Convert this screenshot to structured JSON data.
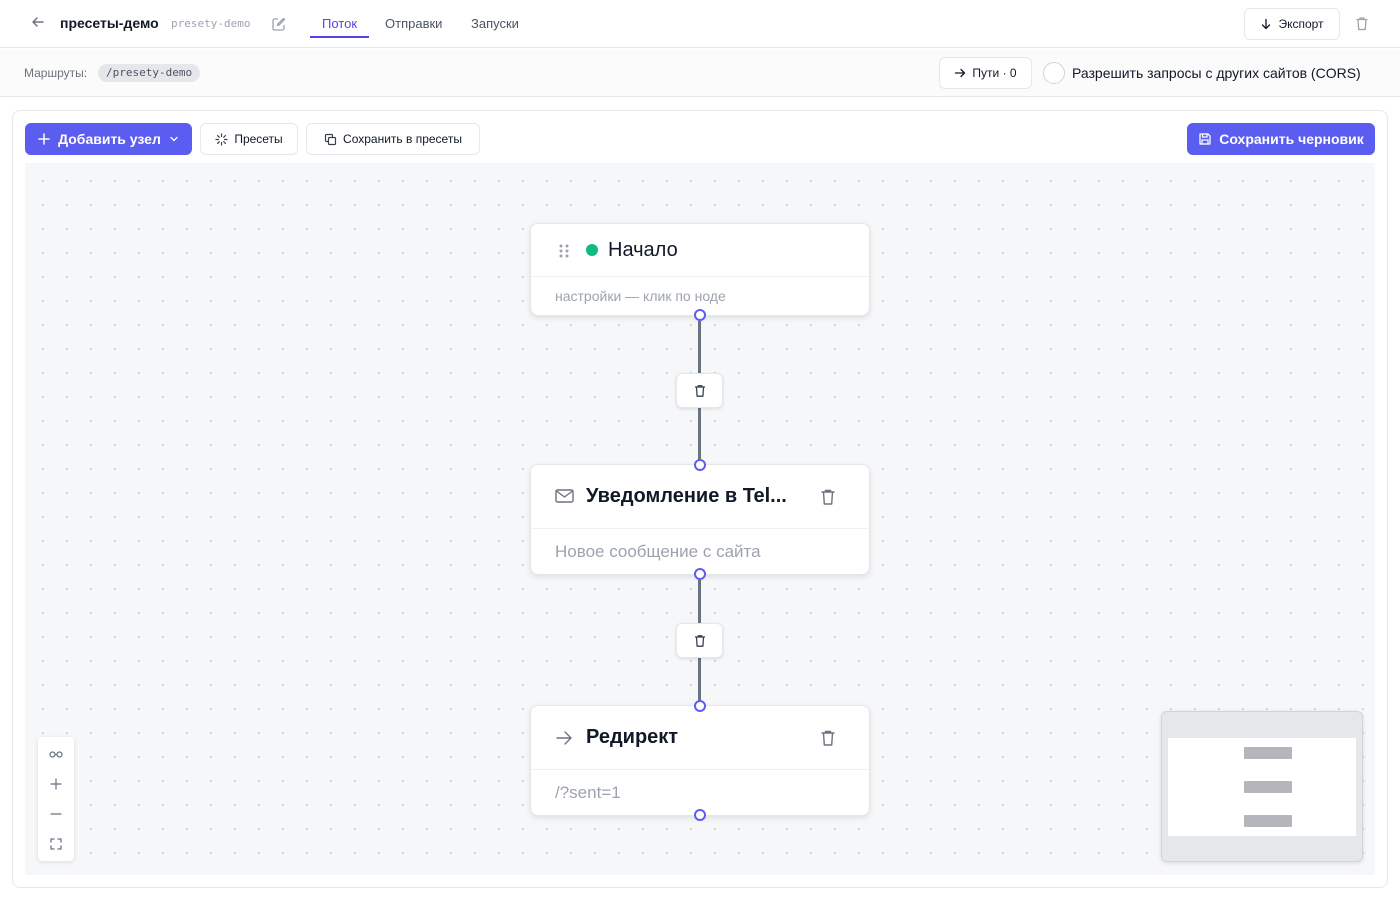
{
  "header": {
    "back_icon": "arrow-left-icon",
    "project_title": "пресеты-демо",
    "project_slug": "presety-demo",
    "edit_icon": "pencil-square-icon",
    "tabs": [
      {
        "label": "Поток",
        "active": true
      },
      {
        "label": "Отправки",
        "active": false
      },
      {
        "label": "Запуски",
        "active": false
      }
    ],
    "export_label": "Экспорт",
    "export_icon": "arrow-down-icon",
    "delete_icon": "trash-icon"
  },
  "routes": {
    "label": "Маршруты:",
    "route": "/presety-demo",
    "paths_label": "Пути · 0",
    "paths_icon": "arrow-right-icon",
    "cors_label": "Разрешить запросы с других сайтов (CORS)",
    "cors_enabled": false
  },
  "toolbar": {
    "add_node_label": "Добавить узел",
    "add_node_icon": "plus-icon",
    "add_node_caret": "chevron-down-icon",
    "presets_label": "Пресеты",
    "presets_icon": "sparkle-icon",
    "save_to_presets_label": "Сохранить в пресеты",
    "save_to_presets_icon": "copy-icon",
    "save_draft_label": "Сохранить черновик",
    "save_draft_icon": "floppy-disk-icon",
    "accent_color": "#5b5cf0"
  },
  "flow": {
    "nodes": [
      {
        "title": "Начало",
        "subtitle": "настройки — клик по ноде",
        "icon": "drag-grip-icon",
        "status_color": "#10b981"
      },
      {
        "title": "Уведомление в Tel...",
        "subtitle": "Новое сообщение с сайта",
        "icon": "envelope-icon"
      },
      {
        "title": "Редирект",
        "subtitle": "/?sent=1",
        "icon": "arrow-right-icon"
      }
    ],
    "edge_delete_icon": "trash-icon"
  },
  "controls": {
    "fit_icon": "binoculars-icon",
    "zoom_in_icon": "plus-icon",
    "zoom_out_icon": "minus-icon",
    "fullscreen_icon": "expand-corners-icon"
  }
}
